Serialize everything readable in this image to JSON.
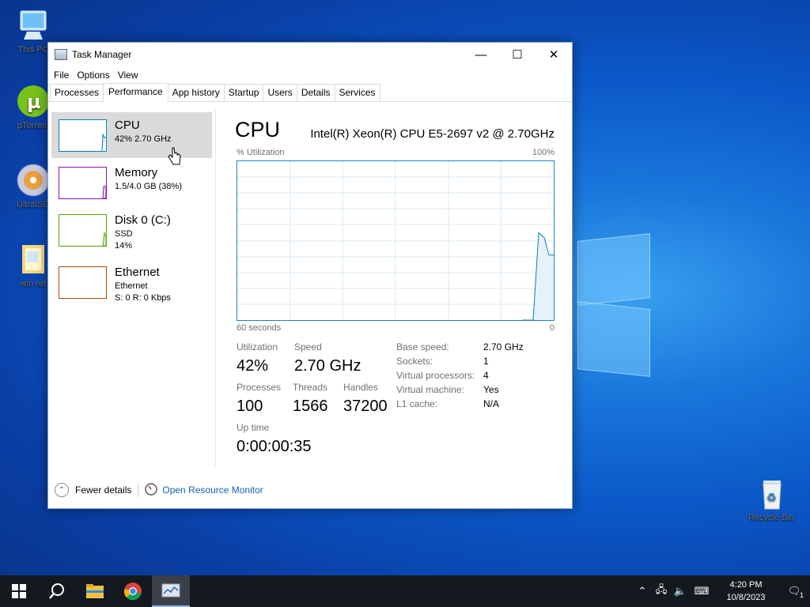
{
  "desktop": {
    "icons": [
      {
        "label": "This PC",
        "icon": "this-pc-icon"
      },
      {
        "label": "µTorrent",
        "icon": "utorrent-icon"
      },
      {
        "label": "UltraISO",
        "icon": "ultraiso-icon"
      },
      {
        "label": "win ret",
        "icon": "folder-icon"
      },
      {
        "label": "Recycle Bin",
        "icon": "recycle-bin-icon"
      }
    ]
  },
  "window": {
    "title": "Task Manager",
    "controls": {
      "minimize": "—",
      "maximize": "☐",
      "close": "✕"
    },
    "menu": [
      "File",
      "Options",
      "View"
    ],
    "tabs": [
      "Processes",
      "Performance",
      "App history",
      "Startup",
      "Users",
      "Details",
      "Services"
    ],
    "active_tab": "Performance"
  },
  "sidebar": [
    {
      "name": "CPU",
      "lines": [
        "42% 2.70 GHz"
      ],
      "color": "#117dbb",
      "selected": true
    },
    {
      "name": "Memory",
      "lines": [
        "1.5/4.0 GB (38%)"
      ],
      "color": "#8b12ae"
    },
    {
      "name": "Disk 0 (C:)",
      "lines": [
        "SSD",
        "14%"
      ],
      "color": "#4da60c"
    },
    {
      "name": "Ethernet",
      "lines": [
        "Ethernet",
        "S: 0 R: 0 Kbps"
      ],
      "color": "#a74f01"
    }
  ],
  "cpu": {
    "title": "CPU",
    "model": "Intel(R) Xeon(R) CPU E5-2697 v2 @ 2.70GHz",
    "graph": {
      "y_label": "% Utilization",
      "y_max_label": "100%",
      "x_left_label": "60 seconds",
      "x_right_label": "0",
      "recent_values": [
        0,
        0,
        55,
        52,
        41,
        41
      ]
    },
    "stats": {
      "utilization_label": "Utilization",
      "utilization": "42%",
      "speed_label": "Speed",
      "speed": "2.70 GHz",
      "processes_label": "Processes",
      "processes": "100",
      "threads_label": "Threads",
      "threads": "1566",
      "handles_label": "Handles",
      "handles": "37200",
      "uptime_label": "Up time",
      "uptime": "0:00:00:35"
    },
    "details": [
      {
        "key": "Base speed:",
        "value": "2.70 GHz"
      },
      {
        "key": "Sockets:",
        "value": "1"
      },
      {
        "key": "Virtual processors:",
        "value": "4"
      },
      {
        "key": "Virtual machine:",
        "value": "Yes"
      },
      {
        "key": "L1 cache:",
        "value": "N/A"
      }
    ]
  },
  "footer": {
    "fewer_details": "Fewer details",
    "open_resource_monitor": "Open Resource Monitor"
  },
  "taskbar": {
    "time": "4:20 PM",
    "date": "10/8/2023",
    "notification_count": "1"
  }
}
